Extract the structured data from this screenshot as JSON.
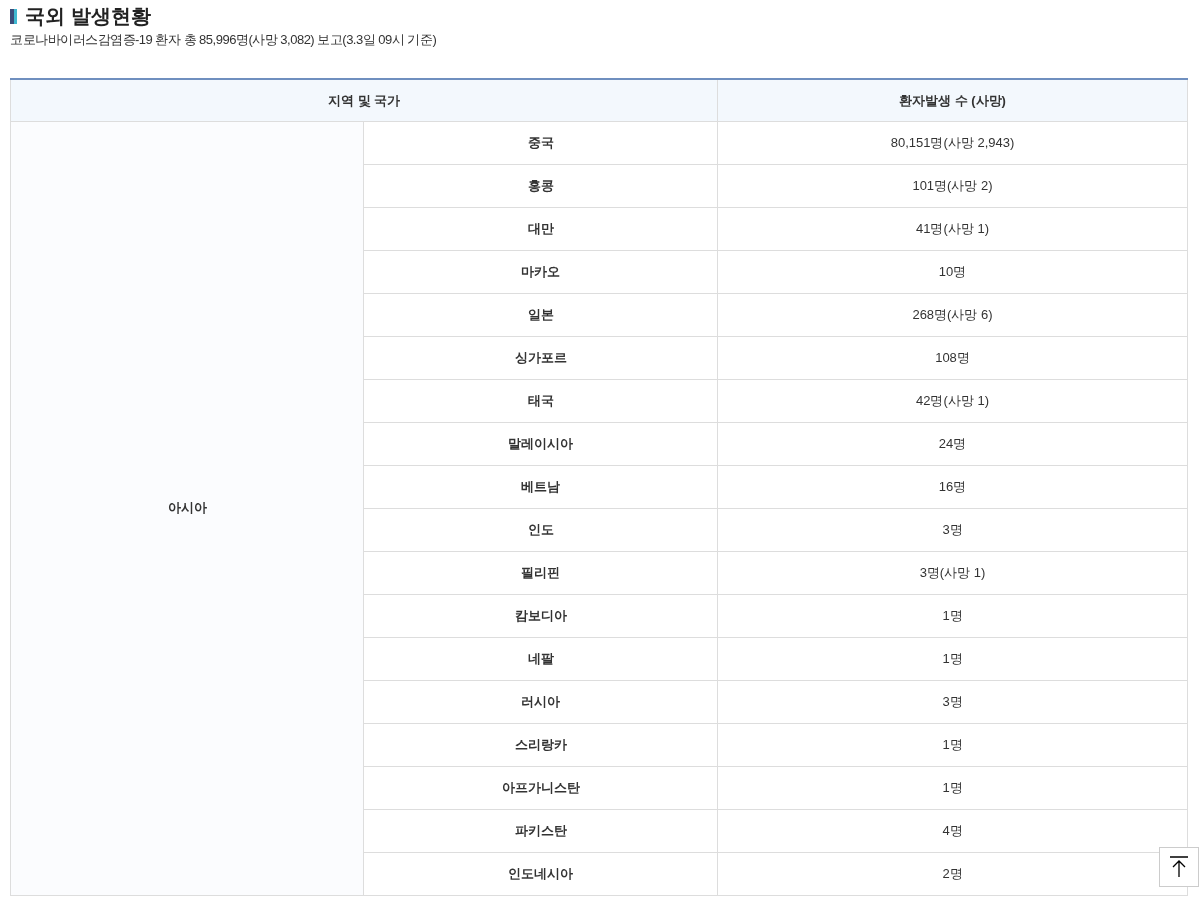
{
  "title": "국외 발생현황",
  "summary": "코로나바이러스감염증-19 환자 총 85,996명(사망 3,082) 보고(3.3일 09시 기준)",
  "table": {
    "columns": [
      "지역 및 국가",
      "환자발생 수 (사망)"
    ],
    "groups": [
      {
        "region": "아시아",
        "rows": [
          {
            "country": "중국",
            "cases": "80,151명(사망 2,943)"
          },
          {
            "country": "홍콩",
            "cases": "101명(사망 2)"
          },
          {
            "country": "대만",
            "cases": "41명(사망 1)"
          },
          {
            "country": "마카오",
            "cases": "10명"
          },
          {
            "country": "일본",
            "cases": "268명(사망 6)"
          },
          {
            "country": "싱가포르",
            "cases": "108명"
          },
          {
            "country": "태국",
            "cases": "42명(사망 1)"
          },
          {
            "country": "말레이시아",
            "cases": "24명"
          },
          {
            "country": "베트남",
            "cases": "16명"
          },
          {
            "country": "인도",
            "cases": "3명"
          },
          {
            "country": "필리핀",
            "cases": "3명(사망 1)"
          },
          {
            "country": "캄보디아",
            "cases": "1명"
          },
          {
            "country": "네팔",
            "cases": "1명"
          },
          {
            "country": "러시아",
            "cases": "3명"
          },
          {
            "country": "스리랑카",
            "cases": "1명"
          },
          {
            "country": "아프가니스탄",
            "cases": "1명"
          },
          {
            "country": "파키스탄",
            "cases": "4명"
          },
          {
            "country": "인도네시아",
            "cases": "2명"
          }
        ]
      }
    ]
  }
}
